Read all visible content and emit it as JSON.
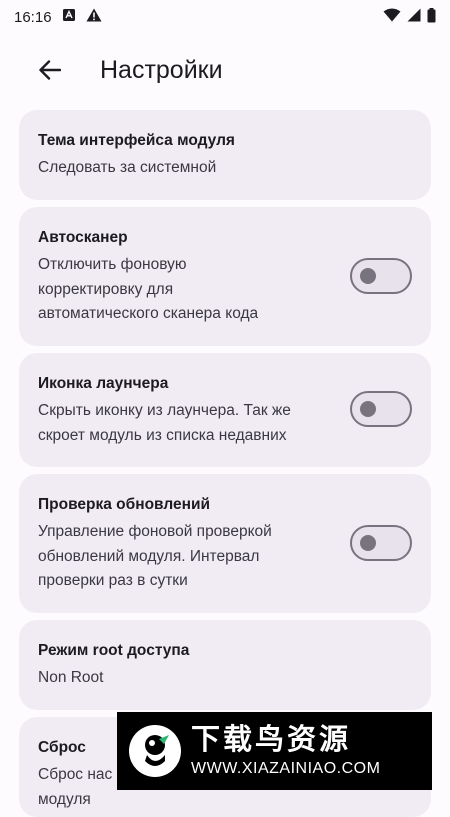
{
  "status": {
    "time": "16:16"
  },
  "app_bar": {
    "title": "Настройки"
  },
  "settings": [
    {
      "title": "Тема интерфейса модуля",
      "subtitle": "Следовать за системной"
    },
    {
      "title": "Автосканер",
      "subtitle_lines": [
        "Отключить фоновую",
        "корректировку для",
        "автоматического сканера кода"
      ],
      "toggle": false
    },
    {
      "title": "Иконка лаунчера",
      "subtitle_lines": [
        "Скрыть иконку из лаунчера. Так же",
        "скроет модуль из списка недавних"
      ],
      "toggle": false
    },
    {
      "title": "Проверка обновлений",
      "subtitle_lines": [
        "Управление фоновой проверкой",
        "обновлений модуля. Интервал",
        "проверки раз в сутки"
      ],
      "toggle": false
    },
    {
      "title": "Режим root доступа",
      "subtitle": "Non Root"
    },
    {
      "title": "Сброс",
      "subtitle_lines": [
        "Сброс нас",
        "модуля"
      ]
    }
  ],
  "watermark": {
    "title": "下载鸟资源",
    "url": "WWW.XIAZAINIAO.COM"
  },
  "colors": {
    "card_bg": "#f1ecf4",
    "page_bg": "#fefbff",
    "switch_outline": "#77737f"
  }
}
